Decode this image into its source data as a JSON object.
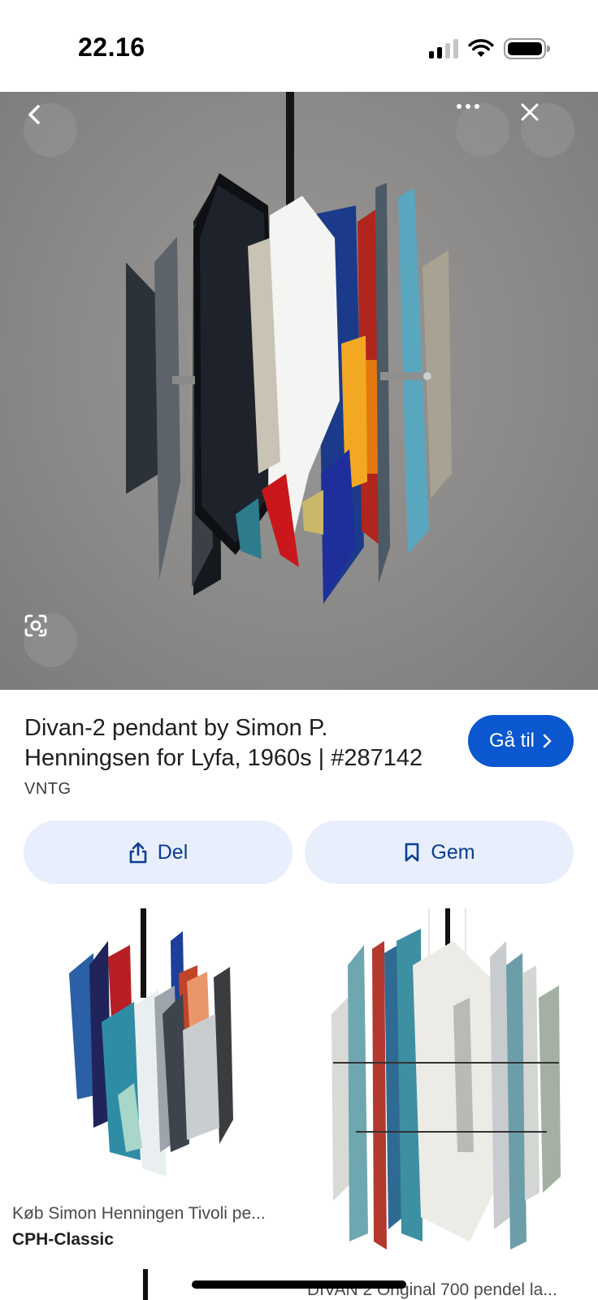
{
  "status_bar": {
    "time": "22.16"
  },
  "hero": {
    "back_icon": "chevron-left-icon",
    "more_icon": "more-horizontal-icon",
    "close_icon": "close-icon",
    "lens_icon": "lens-icon"
  },
  "result": {
    "title": "Divan-2 pendant by Simon P. Henningsen for Lyfa, 1960s | #287142",
    "source": "VNTG",
    "goto_label": "Gå til",
    "goto_icon": "chevron-right-icon"
  },
  "actions": {
    "share_label": "Del",
    "share_icon": "share-icon",
    "save_label": "Gem",
    "save_icon": "bookmark-icon"
  },
  "related": [
    {
      "title": "Køb Simon Henningen Tivoli pe...",
      "source": "CPH-Classic"
    },
    {
      "title": "DIVAN 2 Original 700 pendel la..."
    }
  ],
  "colors": {
    "accent": "#0b57d0",
    "action_bg": "#e8eefc",
    "action_text": "#0b3d91"
  }
}
